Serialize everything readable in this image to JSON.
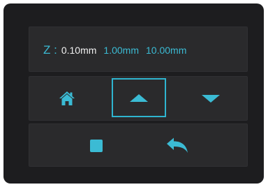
{
  "z_axis": {
    "label": "Z :",
    "steps": [
      {
        "label": "0.10mm",
        "selected": true
      },
      {
        "label": "1.00mm",
        "selected": false
      },
      {
        "label": "10.00mm",
        "selected": false
      }
    ]
  },
  "controls": {
    "home_icon": "home-icon",
    "up_icon": "triangle-up-icon",
    "down_icon": "triangle-down-icon",
    "up_selected": true,
    "stop_icon": "stop-square-icon",
    "back_icon": "back-arrow-icon"
  },
  "colors": {
    "accent": "#3bbbd4",
    "selected_text": "#f0f0f0",
    "panel": "#2a2a2c",
    "background": "#1d1d1f"
  }
}
